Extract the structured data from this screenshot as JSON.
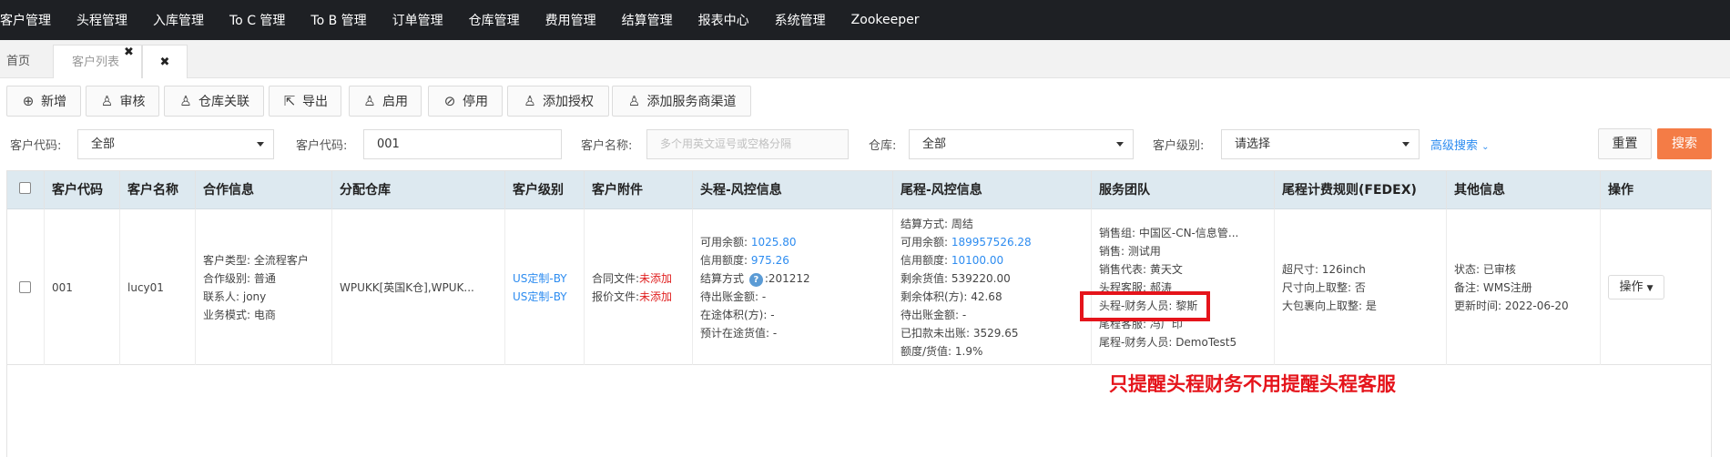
{
  "topnav": {
    "items": [
      "客户管理",
      "头程管理",
      "入库管理",
      "To C 管理",
      "To B 管理",
      "订单管理",
      "仓库管理",
      "费用管理",
      "结算管理",
      "报表中心",
      "系统管理",
      "Zookeeper"
    ]
  },
  "tabs": {
    "home": "首页",
    "customer_list": "客户列表",
    "close_symbol": "✖"
  },
  "toolbar": {
    "add": "新增",
    "audit": "审核",
    "warehouse_link": "仓库关联",
    "export": "导出",
    "enable": "启用",
    "disable": "停用",
    "add_auth": "添加授权",
    "add_provider": "添加服务商渠道"
  },
  "filters": {
    "code_label_1": "客户代码:",
    "code_value_1": "全部",
    "code_label_2": "客户代码:",
    "code_value_2": "001",
    "name_label": "客户名称:",
    "name_placeholder": "多个用英文逗号或空格分隔",
    "warehouse_label": "仓库:",
    "warehouse_value": "全部",
    "level_label": "客户级别:",
    "level_value": "请选择",
    "advanced": "高级搜索",
    "reset": "重置",
    "search": "搜索"
  },
  "table": {
    "headers": [
      "客户代码",
      "客户名称",
      "合作信息",
      "分配仓库",
      "客户级别",
      "客户附件",
      "头程-风控信息",
      "尾程-风控信息",
      "服务团队",
      "尾程计费规则(FEDEX)",
      "其他信息",
      "操作"
    ],
    "row": {
      "code": "001",
      "name": "lucy01",
      "coop": [
        "客户类型: 全流程客户",
        "合作级别: 普通",
        "联系人: jony",
        "业务模式: 电商"
      ],
      "warehouse": "WPUKK[英国K仓],WPUK...",
      "level": [
        "US定制-BY",
        "US定制-BY"
      ],
      "attach": [
        {
          "label": "合同文件:",
          "status": "未添加"
        },
        {
          "label": "报价文件:",
          "status": "未添加"
        }
      ],
      "head_risk": {
        "balance_label": "可用余额:",
        "balance": "1025.80",
        "credit_label": "信用额度:",
        "credit": "975.26",
        "settle_label": "结算方式",
        "settle_value": ":201212",
        "pending_out": "待出账金额: -",
        "in_transit": "在途体积(方): -",
        "expected": "预计在途货值: -"
      },
      "tail_risk": {
        "settle": "结算方式: 周结",
        "balance_label": "可用余额:",
        "balance": "189957526.28",
        "credit_label": "信用额度:",
        "credit": "10100.00",
        "remaining_value": "剩余货值: 539220.00",
        "remaining_volume": "剩余体积(方): 42.68",
        "pending_out": "待出账金额: -",
        "deducted": "已扣款未出账: 3529.65",
        "ratio": "额度/货值: 1.9%"
      },
      "team": [
        "销售组: 中国区-CN-信息管...",
        "销售: 测试用",
        "销售代表: 黄天文",
        "头程客服: 郝涛",
        "头程-财务人员: 黎斯",
        "尾程客服: 冯广印",
        "尾程-财务人员: DemoTest5"
      ],
      "fedex": [
        "超尺寸: 126inch",
        "尺寸向上取整: 否",
        "大包裹向上取整: 是"
      ],
      "other": [
        "状态: 已审核",
        "备注: WMS注册",
        "更新时间: 2022-06-20"
      ],
      "action": "操作"
    }
  },
  "annotation": "只提醒头程财务不用提醒头程客服",
  "colors": {
    "accent_orange": "#f47c46",
    "link_blue": "#2d8cf0",
    "alert_red": "#e5141b",
    "nav_bg": "#1e2024"
  }
}
